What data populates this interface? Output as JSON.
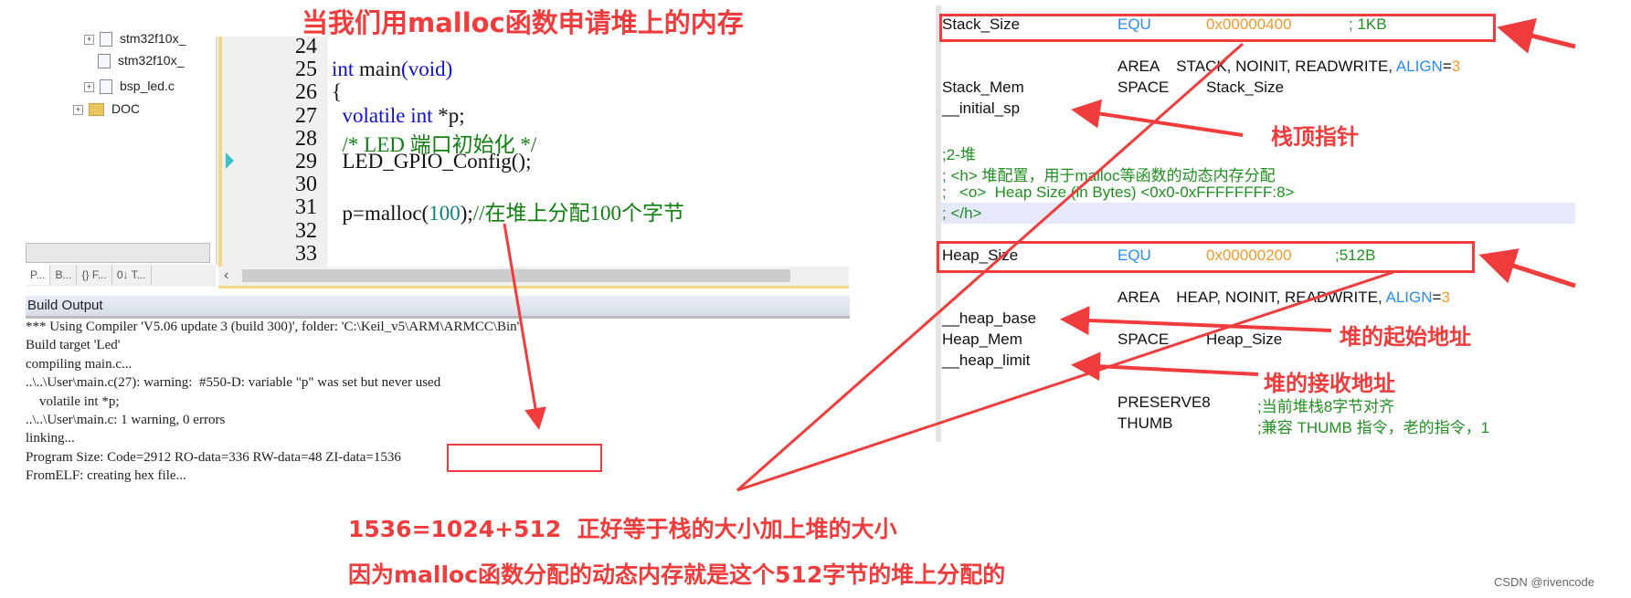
{
  "title": "当我们用malloc函数申请堆上的内存",
  "tree": {
    "items": [
      "stm32f10x_",
      "stm32f10x_",
      "bsp_led.c",
      "DOC"
    ]
  },
  "panel_tabs": [
    "P...",
    "B...",
    "{} F...",
    "0↓ T..."
  ],
  "editor": {
    "lines": [
      {
        "n": "24",
        "code": []
      },
      {
        "n": "25",
        "code": [
          {
            "t": "int ",
            "c": "kw"
          },
          {
            "t": "main",
            "c": ""
          },
          {
            "t": "(void)",
            "c": "kw"
          }
        ]
      },
      {
        "n": "26",
        "code": [
          {
            "t": "{",
            "c": ""
          }
        ]
      },
      {
        "n": "27",
        "code": [
          {
            "t": "  volatile int ",
            "c": "kw"
          },
          {
            "t": "*p;",
            "c": ""
          }
        ]
      },
      {
        "n": "28",
        "code": [
          {
            "t": "  /* LED 端口初始化 */",
            "c": "cm"
          }
        ]
      },
      {
        "n": "29",
        "code": [
          {
            "t": "  LED_GPIO_Config();",
            "c": ""
          }
        ]
      },
      {
        "n": "30",
        "code": []
      },
      {
        "n": "31",
        "code": [
          {
            "t": "  p=malloc(",
            "c": ""
          },
          {
            "t": "100",
            "c": "num"
          },
          {
            "t": ");",
            "c": ""
          },
          {
            "t": "//在堆上分配100个字节",
            "c": "cm"
          }
        ]
      },
      {
        "n": "32",
        "code": []
      },
      {
        "n": "33",
        "code": []
      }
    ]
  },
  "build_output": {
    "title": "Build Output",
    "lines": [
      "*** Using Compiler 'V5.06 update 3 (build 300)', folder: 'C:\\Keil_v5\\ARM\\ARMCC\\Bin'",
      "Build target 'Led'",
      "compiling main.c...",
      "..\\..\\User\\main.c(27): warning:  #550-D: variable \"p\" was set but never used",
      "    volatile int *p;",
      "..\\..\\User\\main.c: 1 warning, 0 errors",
      "linking...",
      "Program Size: Code=2912 RO-data=336 RW-data=48 ZI-data=1536",
      "FromELF: creating hex file..."
    ]
  },
  "asm": {
    "stack_size": [
      "Stack_Size",
      "EQU",
      "0x00000400",
      "; 1KB"
    ],
    "stack_area": [
      "AREA",
      "STACK, NOINIT, READWRITE, ",
      "ALIGN",
      "=",
      "3"
    ],
    "stack_mem": [
      "Stack_Mem",
      "SPACE",
      "Stack_Size"
    ],
    "initial_sp": "__initial_sp",
    "c1": ";2-堆",
    "c2": "; <h> 堆配置，用于malloc等函数的动态内存分配",
    "c3": ";   <o>  Heap Size (in Bytes) <0x0-0xFFFFFFFF:8>",
    "c4": "; </h>",
    "heap_size": [
      "Heap_Size",
      "EQU",
      "0x00000200",
      ";512B"
    ],
    "heap_area": [
      "AREA",
      "HEAP, NOINIT, READWRITE, ",
      "ALIGN",
      "=",
      "3"
    ],
    "heap_base": "__heap_base",
    "heap_mem": [
      "Heap_Mem",
      "SPACE",
      "Heap_Size"
    ],
    "heap_limit": "__heap_limit",
    "preserve": [
      "PRESERVE8",
      ";当前堆栈8字节对齐"
    ],
    "thumb": [
      "THUMB",
      ";兼容 THUMB 指令，老的指令，1"
    ]
  },
  "annotations": {
    "sp": "栈顶指针",
    "heap_start": "堆的起始地址",
    "heap_end": "堆的接收地址",
    "eq": "1536=1024+512  正好等于栈的大小加上堆的大小",
    "why": "因为malloc函数分配的动态内存就是这个512字节的堆上分配的"
  },
  "credit": "CSDN @rivencode",
  "colors": {
    "annotation": "#f03c3c",
    "keyword": "#1010d0",
    "comment": "#108010",
    "asm_blue": "#2a8cf0",
    "asm_orange": "#f39a2a"
  }
}
